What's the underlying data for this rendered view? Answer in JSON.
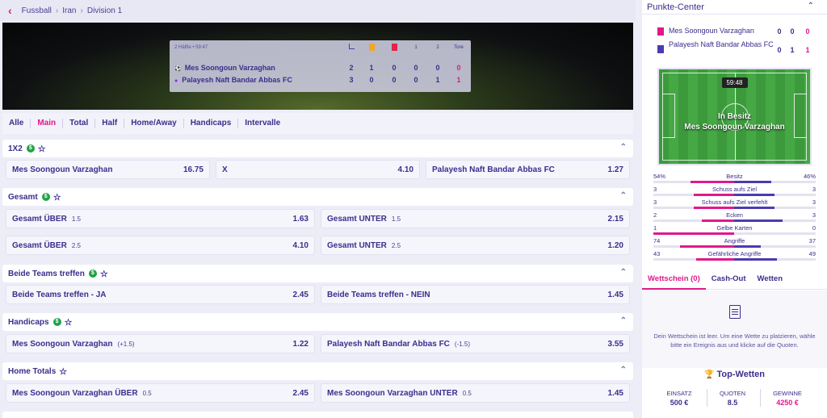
{
  "breadcrumb": {
    "back_icon": "chevron-left-icon",
    "items": [
      "Fussball",
      "Iran",
      "Division 1"
    ]
  },
  "scoreboard": {
    "period": "2 Hälfte • 59:47",
    "headers": [
      "corner-icon",
      "yellow-card-icon",
      "red-card-icon",
      "1",
      "2",
      "Tore"
    ],
    "teams": [
      {
        "name": "Mes Soongoun Varzaghan",
        "corners": "2",
        "yellow": "1",
        "red": "0",
        "h1": "0",
        "h2": "0",
        "goals": "0"
      },
      {
        "name": "Palayesh Naft Bandar Abbas FC",
        "corners": "3",
        "yellow": "0",
        "red": "0",
        "h1": "0",
        "h2": "1",
        "goals": "1"
      }
    ]
  },
  "tabs": [
    "Alle",
    "Main",
    "Total",
    "Half",
    "Home/Away",
    "Handicaps",
    "Intervalle"
  ],
  "active_tab": "Main",
  "markets": [
    {
      "title": "1X2",
      "odds": [
        [
          "Mes Soongoun Varzaghan",
          "",
          "16.75"
        ],
        [
          "X",
          "",
          "4.10"
        ],
        [
          "Palayesh Naft Bandar Abbas FC",
          "",
          "1.27"
        ]
      ]
    },
    {
      "title": "Gesamt",
      "odds": [
        [
          "Gesamt ÜBER",
          "1.5",
          "1.63"
        ],
        [
          "Gesamt UNTER",
          "1.5",
          "2.15"
        ],
        [
          "Gesamt ÜBER",
          "2.5",
          "4.10"
        ],
        [
          "Gesamt UNTER",
          "2.5",
          "1.20"
        ]
      ]
    },
    {
      "title": "Beide Teams treffen",
      "odds": [
        [
          "Beide Teams treffen - JA",
          "",
          "2.45"
        ],
        [
          "Beide Teams treffen - NEIN",
          "",
          "1.45"
        ]
      ]
    },
    {
      "title": "Handicaps",
      "odds": [
        [
          "Mes Soongoun Varzaghan",
          "(+1.5)",
          "1.22"
        ],
        [
          "Palayesh Naft Bandar Abbas FC",
          "(-1.5)",
          "3.55"
        ]
      ]
    },
    {
      "title": "Home Totals",
      "odds": [
        [
          "Mes Soongoun Varzaghan ÜBER",
          "0.5",
          "2.45"
        ],
        [
          "Mes Soongoun Varzaghan UNTER",
          "0.5",
          "1.45"
        ]
      ]
    }
  ],
  "punkte": {
    "title": "Punkte-Center",
    "teams": [
      {
        "name": "Mes Soongoun Varzaghan",
        "a": "0",
        "b": "0",
        "c": "0",
        "color": "#e0198a"
      },
      {
        "name": "Palayesh Naft Bandar Abbas FC",
        "a": "0",
        "b": "1",
        "c": "1",
        "color": "#4b3bb0"
      }
    ],
    "clock": "59:48",
    "possession_line1": "In Besitz",
    "possession_line2": "Mes Soongoun Varzaghan",
    "stats": [
      {
        "name": "Besitz",
        "l": "54%",
        "r": "46%",
        "lv": 54,
        "rv": 46
      },
      {
        "name": "Schuss aufs Ziel",
        "l": "3",
        "r": "3",
        "lv": 3,
        "rv": 3
      },
      {
        "name": "Schuss aufs Ziel verfehlt",
        "l": "3",
        "r": "3",
        "lv": 3,
        "rv": 3
      },
      {
        "name": "Ecken",
        "l": "2",
        "r": "3",
        "lv": 2,
        "rv": 3
      },
      {
        "name": "Gelbe Karten",
        "l": "1",
        "r": "0",
        "lv": 1,
        "rv": 0
      },
      {
        "name": "Angriffe",
        "l": "74",
        "r": "37",
        "lv": 74,
        "rv": 37
      },
      {
        "name": "Gefährliche Angriffe",
        "l": "43",
        "r": "49",
        "lv": 43,
        "rv": 49
      }
    ]
  },
  "slip": {
    "tabs": [
      "Wettschein (0)",
      "Cash-Out",
      "Wetten"
    ],
    "empty_msg": "Dein Wettschein ist leer. Um eine Wette zu platzieren, wähle bitte ein Ereignis aus und klicke auf die Quoten.",
    "top_title": "Top-Wetten",
    "einsatz_label": "EINSATZ",
    "einsatz": "500 €",
    "quoten_label": "QUOTEN",
    "quoten": "8.5",
    "gewinne_label": "GEWINNE",
    "gewinne": "4250 €"
  }
}
